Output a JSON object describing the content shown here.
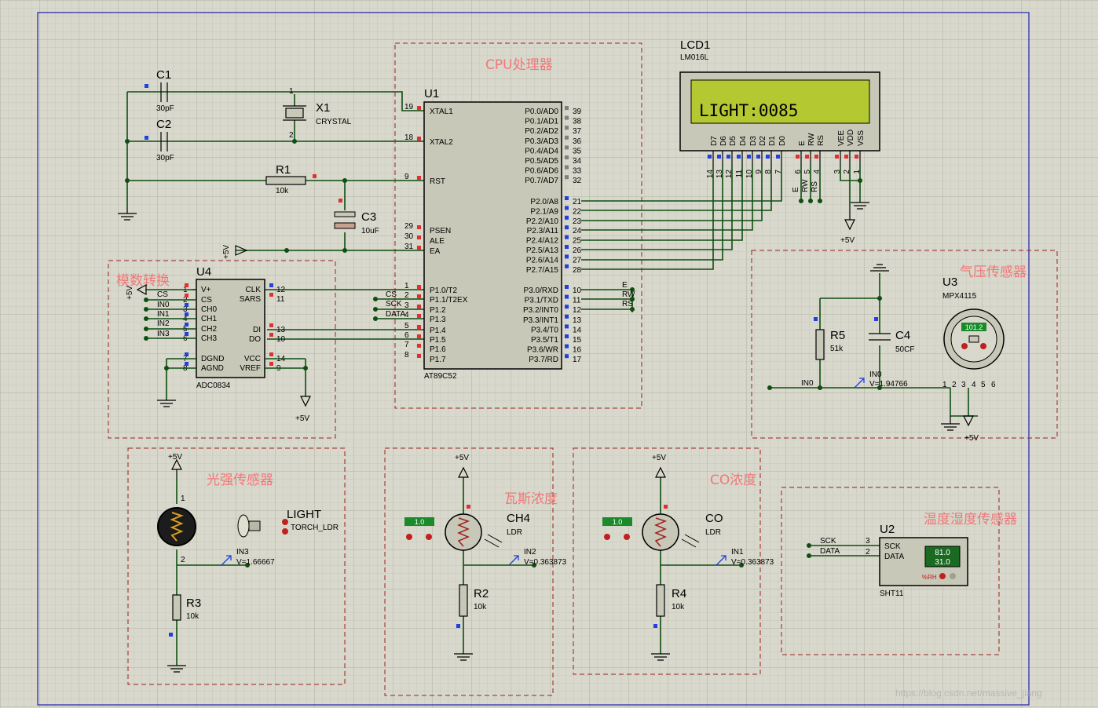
{
  "colors": {
    "background": "#d8d8cc",
    "wire": "#0e4e10",
    "group_label": "#f07878",
    "group_border": "#9a2020",
    "lcd_screen": "#b4c832",
    "chip_fill": "#c8c8b8"
  },
  "watermark": "https://blog.csdn.net/massive_jiang",
  "groups": {
    "cpu": "CPU处理器",
    "adc": "模数转换",
    "pressure": "气压传感器",
    "light": "光强传感器",
    "gas": "瓦斯浓度",
    "co": "CO浓度",
    "temp_humidity": "温度湿度传感器"
  },
  "u1": {
    "ref": "U1",
    "part": "AT89C52",
    "left_pins": [
      {
        "num": "19",
        "name": "XTAL1"
      },
      {
        "num": "18",
        "name": "XTAL2"
      },
      {
        "num": "9",
        "name": "RST"
      },
      {
        "num": "29",
        "name": "PSEN"
      },
      {
        "num": "30",
        "name": "ALE"
      },
      {
        "num": "31",
        "name": "EA"
      },
      {
        "num": "1",
        "name": "P1.0/T2"
      },
      {
        "num": "2",
        "name": "P1.1/T2EX"
      },
      {
        "num": "3",
        "name": "P1.2"
      },
      {
        "num": "4",
        "name": "P1.3"
      },
      {
        "num": "5",
        "name": "P1.4"
      },
      {
        "num": "6",
        "name": "P1.5"
      },
      {
        "num": "7",
        "name": "P1.6"
      },
      {
        "num": "8",
        "name": "P1.7"
      }
    ],
    "right_pins": [
      {
        "num": "39",
        "name": "P0.0/AD0"
      },
      {
        "num": "38",
        "name": "P0.1/AD1"
      },
      {
        "num": "37",
        "name": "P0.2/AD2"
      },
      {
        "num": "36",
        "name": "P0.3/AD3"
      },
      {
        "num": "35",
        "name": "P0.4/AD4"
      },
      {
        "num": "34",
        "name": "P0.5/AD5"
      },
      {
        "num": "33",
        "name": "P0.6/AD6"
      },
      {
        "num": "32",
        "name": "P0.7/AD7"
      },
      {
        "num": "21",
        "name": "P2.0/A8"
      },
      {
        "num": "22",
        "name": "P2.1/A9"
      },
      {
        "num": "23",
        "name": "P2.2/A10"
      },
      {
        "num": "24",
        "name": "P2.3/A11"
      },
      {
        "num": "25",
        "name": "P2.4/A12"
      },
      {
        "num": "26",
        "name": "P2.5/A13"
      },
      {
        "num": "27",
        "name": "P2.6/A14"
      },
      {
        "num": "28",
        "name": "P2.7/A15"
      },
      {
        "num": "10",
        "name": "P3.0/RXD"
      },
      {
        "num": "11",
        "name": "P3.1/TXD"
      },
      {
        "num": "12",
        "name": "P3.2/INT0"
      },
      {
        "num": "13",
        "name": "P3.3/INT1"
      },
      {
        "num": "14",
        "name": "P3.4/T0"
      },
      {
        "num": "15",
        "name": "P3.5/T1"
      },
      {
        "num": "16",
        "name": "P3.6/WR"
      },
      {
        "num": "17",
        "name": "P3.7/RD"
      }
    ],
    "net_labels_left": [
      "CS",
      "SCK",
      "DATA"
    ],
    "net_labels_right": [
      "E",
      "RW",
      "RS"
    ]
  },
  "lcd": {
    "ref": "LCD1",
    "part": "LM016L",
    "text": "LIGHT:0085",
    "pins": [
      {
        "name": "D7",
        "num": "14"
      },
      {
        "name": "D6",
        "num": "13"
      },
      {
        "name": "D5",
        "num": "12"
      },
      {
        "name": "D4",
        "num": "11"
      },
      {
        "name": "D3",
        "num": "10"
      },
      {
        "name": "D2",
        "num": "9"
      },
      {
        "name": "D1",
        "num": "8"
      },
      {
        "name": "D0",
        "num": "7"
      },
      {
        "name": "E",
        "num": "6"
      },
      {
        "name": "RW",
        "num": "5"
      },
      {
        "name": "RS",
        "num": "4"
      },
      {
        "name": "VEE",
        "num": "3"
      },
      {
        "name": "VDD",
        "num": "2"
      },
      {
        "name": "VSS",
        "num": "1"
      }
    ],
    "ctrl_labels": [
      "E",
      "RW",
      "RS"
    ],
    "supply": "+5V"
  },
  "passives": {
    "c1": {
      "ref": "C1",
      "value": "30pF"
    },
    "c2": {
      "ref": "C2",
      "value": "30pF"
    },
    "x1": {
      "ref": "X1",
      "value": "CRYSTAL",
      "pin1": "1",
      "pin2": "2"
    },
    "r1": {
      "ref": "R1",
      "value": "10k"
    },
    "c3": {
      "ref": "C3",
      "value": "10uF"
    },
    "r5": {
      "ref": "R5",
      "value": "51k"
    },
    "c4": {
      "ref": "C4",
      "value": "50CF"
    }
  },
  "u4": {
    "ref": "U4",
    "part": "ADC0834",
    "supply": "+5V",
    "vref_supply": "+5V",
    "left_pins": [
      {
        "num": "1",
        "name": "V+"
      },
      {
        "num": "2",
        "name": "CS"
      },
      {
        "num": "3",
        "name": "CH0"
      },
      {
        "num": "4",
        "name": "CH1"
      },
      {
        "num": "5",
        "name": "CH2"
      },
      {
        "num": "6",
        "name": "CH3"
      },
      {
        "num": "7",
        "name": "DGND"
      },
      {
        "num": "8",
        "name": "AGND"
      }
    ],
    "right_pins": [
      {
        "num": "12",
        "name": "CLK"
      },
      {
        "num": "11",
        "name": "SARS"
      },
      {
        "num": "13",
        "name": "DI"
      },
      {
        "num": "10",
        "name": "DO"
      },
      {
        "num": "14",
        "name": "VCC"
      },
      {
        "num": "9",
        "name": "VREF"
      }
    ],
    "inputs": [
      "CS",
      "IN0",
      "IN1",
      "IN2",
      "IN3"
    ]
  },
  "u3": {
    "ref": "U3",
    "part": "MPX4115",
    "display": "101.2",
    "pins": [
      "1",
      "2",
      "3",
      "4",
      "5",
      "6"
    ],
    "net": "IN0",
    "probe": "IN0",
    "voltage": "V=1.94766",
    "supply": "+5V"
  },
  "light_sensor": {
    "ldr_ref": "LIGHT",
    "ldr_part": "TORCH_LDR",
    "pin1": "1",
    "pin2": "2",
    "r_ref": "R3",
    "r_value": "10k",
    "probe": "IN3",
    "voltage": "V=1.66667",
    "supply": "+5V"
  },
  "ch4_sensor": {
    "ref": "CH4",
    "part": "LDR",
    "level": "1.0",
    "r_ref": "R2",
    "r_value": "10k",
    "probe": "IN2",
    "voltage": "V=0.363873",
    "supply": "+5V"
  },
  "co_sensor": {
    "ref": "CO",
    "part": "LDR",
    "level": "1.0",
    "r_ref": "R4",
    "r_value": "10k",
    "probe": "IN1",
    "voltage": "V=0.363873",
    "supply": "+5V"
  },
  "u2": {
    "ref": "U2",
    "part": "SHT11",
    "pins": [
      {
        "num": "3",
        "name": "SCK"
      },
      {
        "num": "2",
        "name": "DATA"
      }
    ],
    "net_labels": [
      "SCK",
      "DATA"
    ],
    "temp": "81.0",
    "humidity": "31.0",
    "unit": "%RH"
  }
}
